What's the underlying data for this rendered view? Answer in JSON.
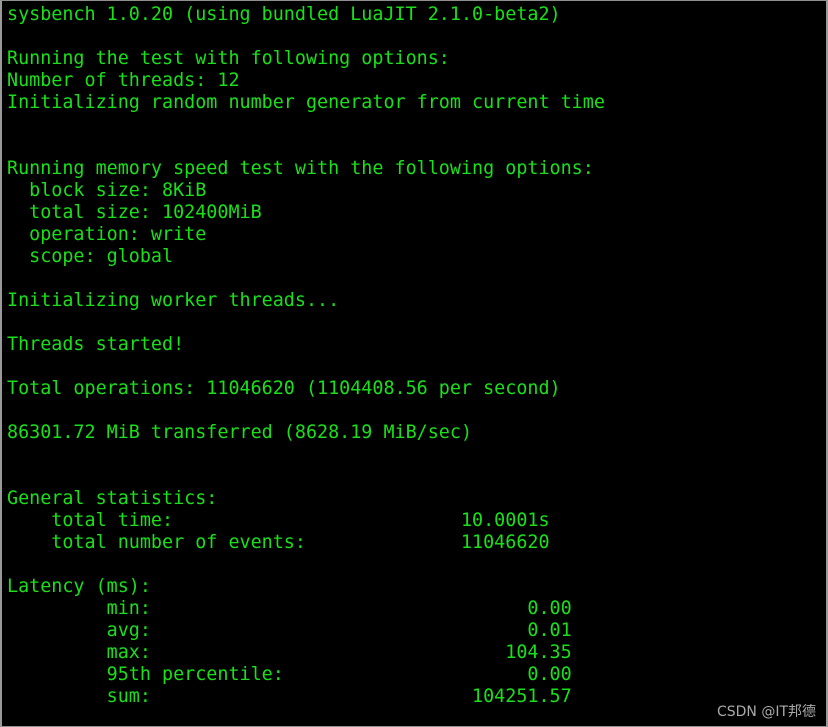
{
  "terminal": {
    "background_color": "#000000",
    "text_color": "#19e019",
    "border_color": "#9a9a9a",
    "watermark": "CSDN @IT邦德",
    "watermark_color": "#b9b9b9"
  },
  "output": {
    "lines": [
      "sysbench 1.0.20 (using bundled LuaJIT 2.1.0-beta2)",
      "",
      "Running the test with following options:",
      "Number of threads: 12",
      "Initializing random number generator from current time",
      "",
      "",
      "Running memory speed test with the following options:",
      "  block size: 8KiB",
      "  total size: 102400MiB",
      "  operation: write",
      "  scope: global",
      "",
      "Initializing worker threads...",
      "",
      "Threads started!",
      "",
      "Total operations: 11046620 (1104408.56 per second)",
      "",
      "86301.72 MiB transferred (8628.19 MiB/sec)",
      "",
      "",
      "General statistics:",
      "    total time:                          10.0001s",
      "    total number of events:              11046620",
      "",
      "Latency (ms):",
      "         min:                                  0.00",
      "         avg:                                  0.01",
      "         max:                                104.35",
      "         95th percentile:                      0.00",
      "         sum:                             104251.57"
    ],
    "fields": {
      "tool_name": "sysbench",
      "tool_version": "1.0.20",
      "luajit_version": "2.1.0-beta2",
      "number_of_threads": "12",
      "rng_seed_source": "current time",
      "block_size": "8KiB",
      "total_size": "102400MiB",
      "operation": "write",
      "scope": "global",
      "total_operations": "11046620",
      "operations_per_second": "1104408.56",
      "transferred_mib": "86301.72",
      "throughput_mib_per_sec": "8628.19",
      "total_time": "10.0001s",
      "total_number_of_events": "11046620",
      "latency_min": "0.00",
      "latency_avg": "0.01",
      "latency_max": "104.35",
      "latency_95th_percentile": "0.00",
      "latency_sum": "104251.57"
    }
  }
}
